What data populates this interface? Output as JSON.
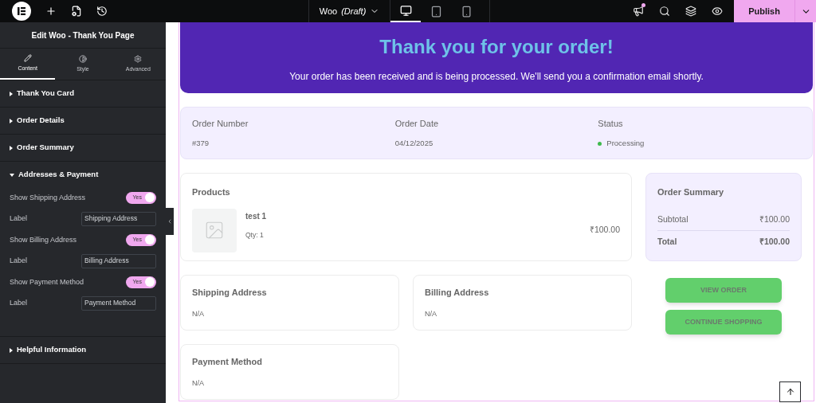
{
  "topbar": {
    "doc_title": "Woo",
    "doc_status": "(Draft)",
    "devices": [
      {
        "kind": "desktop",
        "selected": true
      },
      {
        "kind": "tablet",
        "selected": false
      },
      {
        "kind": "mobile",
        "selected": false
      }
    ],
    "publish": "Publish"
  },
  "panel": {
    "title": "Edit Woo - Thank You Page",
    "tabs": [
      {
        "label": "Content",
        "kind": "content",
        "selected": true
      },
      {
        "label": "Style",
        "kind": "style",
        "selected": false
      },
      {
        "label": "Advanced",
        "kind": "advanced",
        "selected": false
      }
    ],
    "sections": [
      {
        "title": "Thank You Card",
        "expanded": false
      },
      {
        "title": "Order Details",
        "expanded": false
      },
      {
        "title": "Order Summary",
        "expanded": false
      },
      {
        "title": "Addresses & Payment",
        "expanded": true,
        "controls": [
          {
            "kind": "toggle",
            "label": "Show Shipping Address",
            "on": true,
            "text": "Yes"
          },
          {
            "kind": "text",
            "label": "Label",
            "value": "Shipping Address"
          },
          {
            "kind": "toggle",
            "label": "Show Billing Address",
            "on": true,
            "text": "Yes"
          },
          {
            "kind": "text",
            "label": "Label",
            "value": "Billing Address"
          },
          {
            "kind": "toggle",
            "label": "Show Payment Method",
            "on": true,
            "text": "Yes"
          },
          {
            "kind": "text",
            "label": "Label",
            "value": "Payment Method"
          }
        ]
      },
      {
        "title": "Helpful Information",
        "expanded": false
      }
    ]
  },
  "hero": {
    "title": "Thank you for your order!",
    "message": "Your order has been received and is being processed. We'll send you a confirmation email shortly."
  },
  "order_info": [
    {
      "label": "Order Number",
      "value": "#379"
    },
    {
      "label": "Order Date",
      "value": "04/12/2025"
    },
    {
      "label": "Status",
      "value": "Processing",
      "color": "#3fb94d"
    }
  ],
  "products": {
    "title": "Products",
    "items": [
      {
        "name": "test 1",
        "qty": "Qty: 1",
        "price": "₹100.00"
      }
    ]
  },
  "summary": {
    "title": "Order Summary",
    "rows": [
      {
        "label": "Subtotal",
        "value": "₹100.00",
        "kind": "normal"
      },
      {
        "label": "Total",
        "value": "₹100.00",
        "kind": "total"
      }
    ]
  },
  "addresses": [
    {
      "title": "Shipping Address",
      "value": "N/A"
    },
    {
      "title": "Billing Address",
      "value": "N/A"
    },
    {
      "title": "Payment Method",
      "value": "N/A"
    }
  ],
  "buttons": [
    "VIEW ORDER",
    "CONTINUE SHOPPING"
  ]
}
